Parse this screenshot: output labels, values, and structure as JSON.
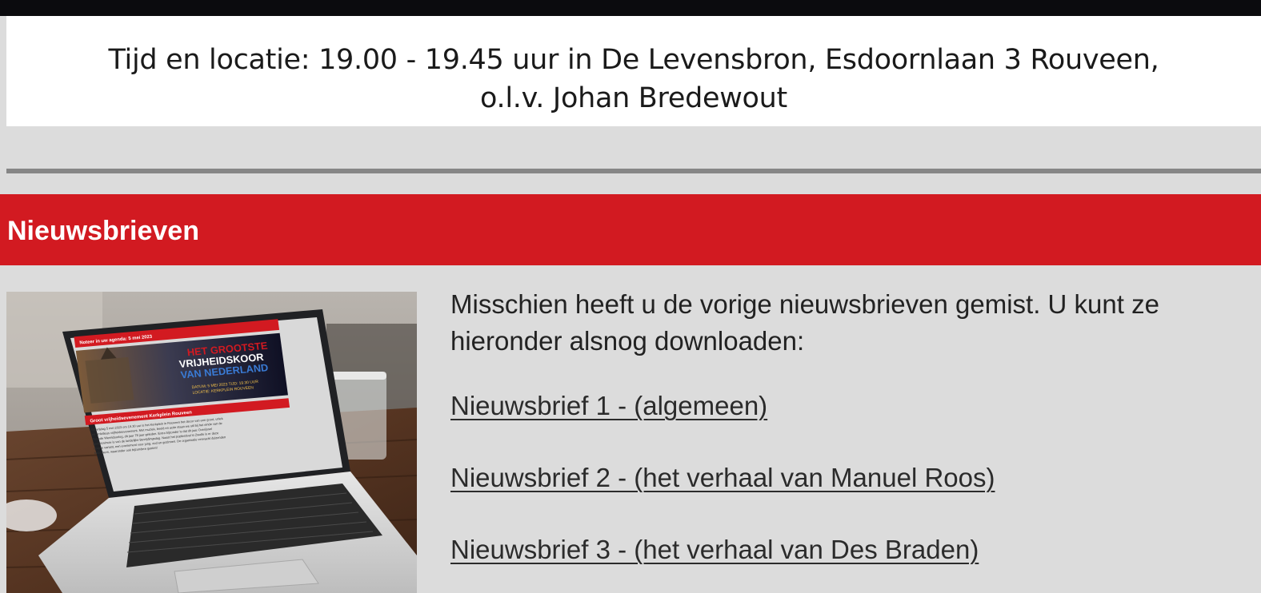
{
  "event_info": {
    "line1": "Tijd en locatie: 19.00 - 19.45 uur in De Levensbron, Esdoornlaan 3 Rouveen,",
    "line2": "o.l.v. Johan Bredewout"
  },
  "newsletters": {
    "heading": "Nieuwsbrieven",
    "intro": "Misschien heeft u de vorige nieuwsbrieven gemist. U kunt ze hieronder alsnog downloaden:",
    "links": [
      {
        "label": "Nieuwsbrief 1 - (algemeen)"
      },
      {
        "label": "Nieuwsbrief 2 - (het verhaal van Manuel Roos)"
      },
      {
        "label": "Nieuwsbrief 3 - (het verhaal van Des Braden)"
      }
    ]
  },
  "photo": {
    "screen_banner": "Noteer in uw agenda: 5 mei 2023",
    "poster_title_1": "HET GROOTSTE",
    "poster_title_2": "VRIJHEIDSKOOR",
    "poster_title_3": "VAN NEDERLAND",
    "poster_date": "DATUM: 5 MEI 2023  TIJD: 19.30 UUR",
    "poster_location": "LOCATIE: KERKPLEIN ROUVEEN",
    "article_title": "Groot vrijheidsevenement Kerkplein Rouveen",
    "article_line_1": "Op vrijdag 5 mei 2023 om 19.30 uur is het Kerkplein in Rouveen het decor van een groot, uniek",
    "article_line_2": "en ambitieus vrijheidsevenement. Met muziek, beeld en actie staan we stil bij het einde van de",
    "article_line_3": "Tweede Wereldoorlog, dit jaar 78 jaar geleden. Extra bijzonder is dat dit jaar Overijssel",
    "article_line_4": "gastprovincie is van de landelijke Bevrijdingsdag. Naast het popfestival in Zwolle is er deze",
    "article_line_5": "dorpse variant, een evenement voor jong, oud en gezinnen. De organisatie verwacht duizenden",
    "article_line_6": "bezoekers, waaronder ook bijzondere gasten!"
  },
  "colors": {
    "accent_red": "#d21a21",
    "page_bg": "#dcdcdc"
  }
}
